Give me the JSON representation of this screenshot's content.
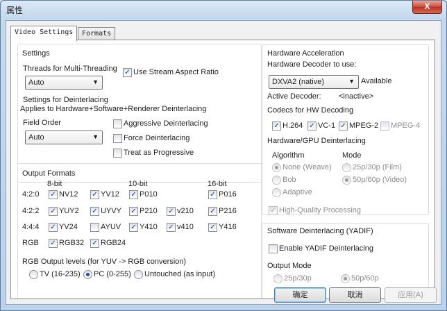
{
  "window": {
    "title": "属性",
    "close_glyph": "X"
  },
  "tabs": [
    {
      "label": "Video Settings",
      "active": true
    },
    {
      "label": "Formats",
      "active": false
    }
  ],
  "settings": {
    "heading": "Settings",
    "threads_label": "Threads for Multi-Threading",
    "threads_value": "Auto",
    "use_stream_aspect": {
      "label": "Use Stream Aspect Ratio",
      "checked": true
    },
    "deint_heading": "Settings for Deinterlacing",
    "deint_note": "Applies to Hardware+Software+Renderer Deinterlacing",
    "field_order_label": "Field Order",
    "field_order_value": "Auto",
    "aggressive": {
      "label": "Aggressive Deinterlacing",
      "checked": false
    },
    "force": {
      "label": "Force Deinterlacing",
      "checked": false
    },
    "progressive": {
      "label": "Treat as Progressive",
      "checked": false
    }
  },
  "output_formats": {
    "heading": "Output Formats",
    "col_8bit": "8-bit",
    "col_10bit": "10-bit",
    "col_16bit": "16-bit",
    "rows": {
      "r420": "4:2:0",
      "r422": "4:2:2",
      "r444": "4:4:4",
      "rgb": "RGB"
    },
    "formats": {
      "nv12": {
        "label": "NV12",
        "checked": true
      },
      "yv12": {
        "label": "YV12",
        "checked": true
      },
      "p010": {
        "label": "P010",
        "checked": true
      },
      "p016": {
        "label": "P016",
        "checked": true
      },
      "yuy2": {
        "label": "YUY2",
        "checked": true
      },
      "uyvy": {
        "label": "UYVY",
        "checked": true
      },
      "p210": {
        "label": "P210",
        "checked": true
      },
      "v210": {
        "label": "v210",
        "checked": true
      },
      "p216": {
        "label": "P216",
        "checked": true
      },
      "yv24": {
        "label": "YV24",
        "checked": true
      },
      "ayuv": {
        "label": "AYUV",
        "checked": false
      },
      "y410": {
        "label": "Y410",
        "checked": true
      },
      "v410": {
        "label": "v410",
        "checked": true
      },
      "y416": {
        "label": "Y416",
        "checked": true
      },
      "rgb32": {
        "label": "RGB32",
        "checked": true
      },
      "rgb24": {
        "label": "RGB24",
        "checked": true
      }
    },
    "rgb_levels_label": "RGB Output levels (for YUV -> RGB conversion)",
    "rgb_levels": [
      {
        "label": "TV (16-235)",
        "selected": false
      },
      {
        "label": "PC (0-255)",
        "selected": true
      },
      {
        "label": "Untouched (as input)",
        "selected": false
      }
    ]
  },
  "hw_accel": {
    "heading": "Hardware Acceleration",
    "decoder_label": "Hardware Decoder to use:",
    "decoder_value": "DXVA2 (native)",
    "decoder_status": "Available",
    "active_label": "Active Decoder:",
    "active_value": "<inactive>",
    "codecs_label": "Codecs for HW Decoding",
    "codecs": {
      "h264": {
        "label": "H.264",
        "checked": true
      },
      "vc1": {
        "label": "VC-1",
        "checked": true
      },
      "mpeg2": {
        "label": "MPEG-2",
        "checked": true
      },
      "mpeg4": {
        "label": "MPEG-4",
        "checked": false
      }
    },
    "gpu_deint_label": "Hardware/GPU Deinterlacing",
    "algorithm_label": "Algorithm",
    "mode_label": "Mode",
    "algorithms": [
      {
        "label": "None (Weave)",
        "selected": true
      },
      {
        "label": "Bob",
        "selected": false
      },
      {
        "label": "Adaptive",
        "selected": false
      }
    ],
    "modes": [
      {
        "label": "25p/30p (Film)",
        "selected": false
      },
      {
        "label": "50p/60p (Video)",
        "selected": true
      }
    ],
    "hq_processing": {
      "label": "High-Quality Processing",
      "checked": true
    }
  },
  "sw_deint": {
    "heading": "Software Deinterlacing (YADIF)",
    "enable": {
      "label": "Enable YADIF Deinterlacing",
      "checked": false
    },
    "output_mode_label": "Output Mode",
    "modes": [
      {
        "label": "25p/30p",
        "selected": false
      },
      {
        "label": "50p/60p",
        "selected": true
      }
    ]
  },
  "buttons": {
    "ok": "确定",
    "cancel": "取消",
    "apply": "应用(A)"
  }
}
